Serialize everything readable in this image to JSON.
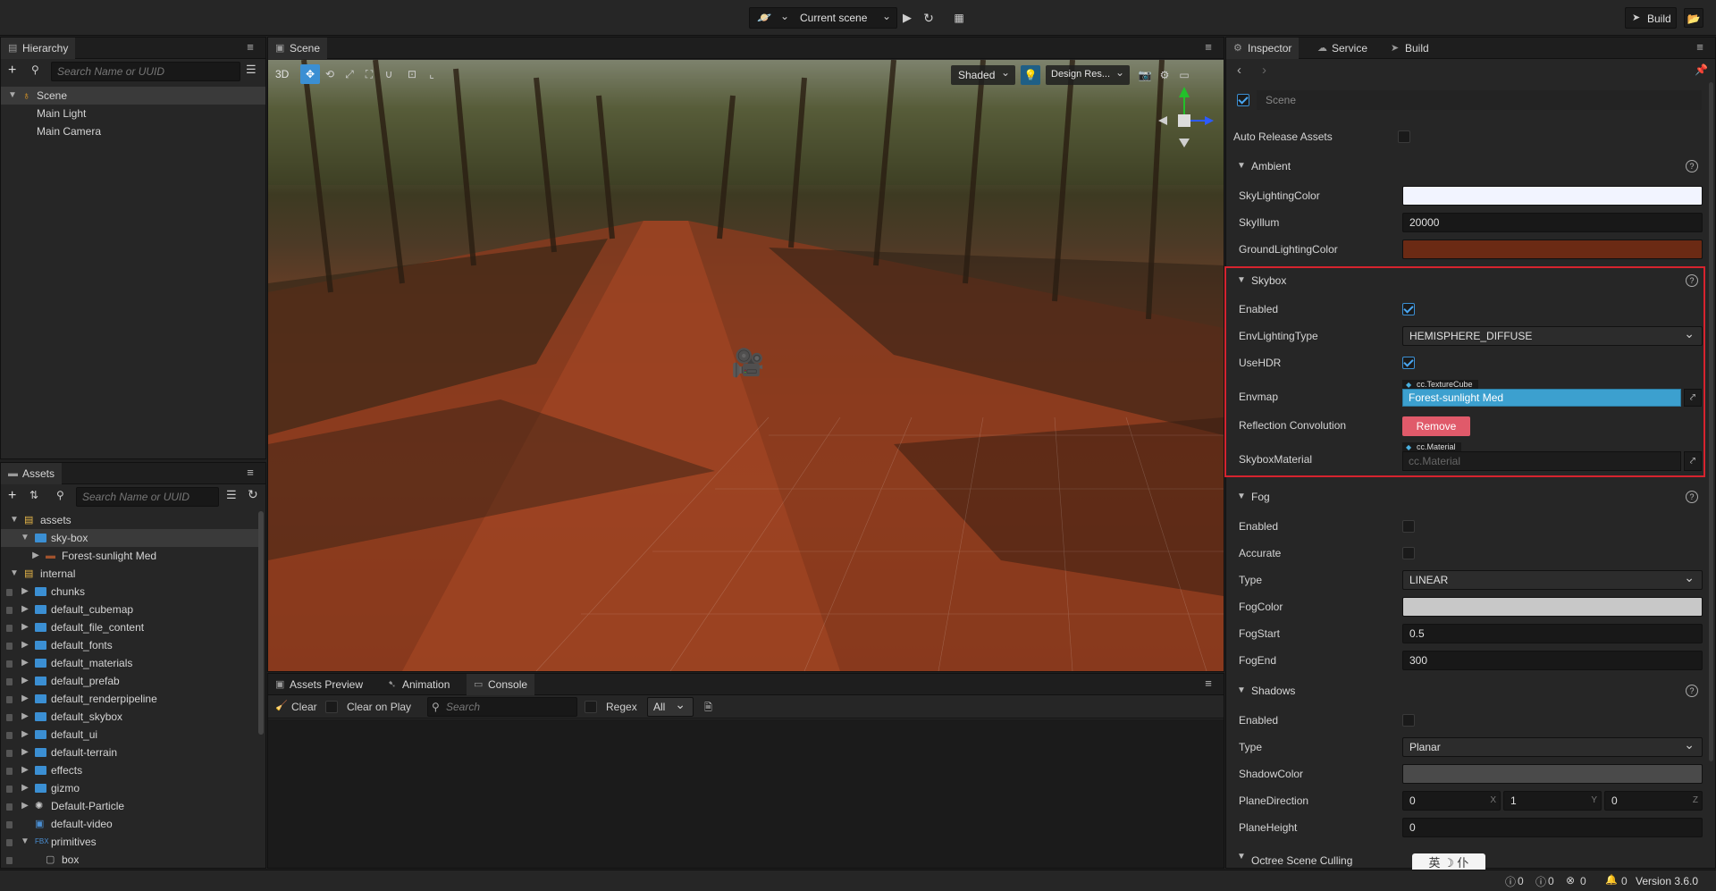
{
  "topbar": {
    "scene_select": "Current scene",
    "build_label": "Build"
  },
  "hierarchy": {
    "tab": "Hierarchy",
    "search_placeholder": "Search Name or UUID",
    "root": "Scene",
    "children": [
      "Main Light",
      "Main Camera"
    ]
  },
  "assets": {
    "tab": "Assets",
    "search_placeholder": "Search Name or UUID",
    "tree": [
      {
        "label": "assets",
        "indent": 0,
        "kind": "db",
        "arrow": "down"
      },
      {
        "label": "sky-box",
        "indent": 1,
        "kind": "folder",
        "arrow": "down",
        "selected": true
      },
      {
        "label": "Forest-sunlight Med",
        "indent": 2,
        "kind": "texture",
        "arrow": "right"
      },
      {
        "label": "internal",
        "indent": 0,
        "kind": "db",
        "arrow": "down"
      },
      {
        "label": "chunks",
        "indent": 1,
        "kind": "folder",
        "arrow": "right",
        "locked": true
      },
      {
        "label": "default_cubemap",
        "indent": 1,
        "kind": "folder",
        "arrow": "right",
        "locked": true
      },
      {
        "label": "default_file_content",
        "indent": 1,
        "kind": "folder",
        "arrow": "right",
        "locked": true
      },
      {
        "label": "default_fonts",
        "indent": 1,
        "kind": "folder",
        "arrow": "right",
        "locked": true
      },
      {
        "label": "default_materials",
        "indent": 1,
        "kind": "folder",
        "arrow": "right",
        "locked": true
      },
      {
        "label": "default_prefab",
        "indent": 1,
        "kind": "folder",
        "arrow": "right",
        "locked": true
      },
      {
        "label": "default_renderpipeline",
        "indent": 1,
        "kind": "folder",
        "arrow": "right",
        "locked": true
      },
      {
        "label": "default_skybox",
        "indent": 1,
        "kind": "folder",
        "arrow": "right",
        "locked": true
      },
      {
        "label": "default_ui",
        "indent": 1,
        "kind": "folder",
        "arrow": "right",
        "locked": true
      },
      {
        "label": "default-terrain",
        "indent": 1,
        "kind": "folder",
        "arrow": "right",
        "locked": true
      },
      {
        "label": "effects",
        "indent": 1,
        "kind": "folder",
        "arrow": "right",
        "locked": true
      },
      {
        "label": "gizmo",
        "indent": 1,
        "kind": "folder",
        "arrow": "right",
        "locked": true
      },
      {
        "label": "Default-Particle",
        "indent": 1,
        "kind": "particle",
        "arrow": "right",
        "locked": true
      },
      {
        "label": "default-video",
        "indent": 1,
        "kind": "video",
        "arrow": "none",
        "locked": true
      },
      {
        "label": "primitives",
        "indent": 1,
        "kind": "fbx",
        "arrow": "down",
        "locked": true
      },
      {
        "label": "box",
        "indent": 2,
        "kind": "mesh",
        "arrow": "none",
        "locked": true
      }
    ]
  },
  "scene": {
    "tab": "Scene",
    "mode_3d": "3D",
    "shading": "Shaded",
    "design_res": "Design Res..."
  },
  "bottom": {
    "tabs": [
      "Assets Preview",
      "Animation",
      "Console"
    ],
    "clear": "Clear",
    "clear_on_play": "Clear on Play",
    "search_placeholder": "Search",
    "regex": "Regex",
    "level": "All"
  },
  "inspector": {
    "tabs": [
      "Inspector",
      "Service",
      "Build"
    ],
    "node_name": "Scene",
    "auto_release": "Auto Release Assets",
    "ambient": {
      "title": "Ambient",
      "sky_color_label": "SkyLightingColor",
      "sky_color": "#f2f4ff",
      "sky_illum_label": "SkyIllum",
      "sky_illum": "20000",
      "ground_color_label": "GroundLightingColor",
      "ground_color": "#6b2a14"
    },
    "skybox": {
      "title": "Skybox",
      "enabled_label": "Enabled",
      "env_type_label": "EnvLightingType",
      "env_type": "HEMISPHERE_DIFFUSE",
      "hdr_label": "UseHDR",
      "envmap_label": "Envmap",
      "envmap_type": "cc.TextureCube",
      "envmap_value": "Forest-sunlight Med",
      "reflection_label": "Reflection Convolution",
      "remove_label": "Remove",
      "material_label": "SkyboxMaterial",
      "material_type": "cc.Material",
      "material_value": "cc.Material"
    },
    "fog": {
      "title": "Fog",
      "enabled_label": "Enabled",
      "accurate_label": "Accurate",
      "type_label": "Type",
      "type": "LINEAR",
      "color_label": "FogColor",
      "color": "#c8c8c8",
      "start_label": "FogStart",
      "start": "0.5",
      "end_label": "FogEnd",
      "end": "300"
    },
    "shadows": {
      "title": "Shadows",
      "enabled_label": "Enabled",
      "type_label": "Type",
      "type": "Planar",
      "color_label": "ShadowColor",
      "color": "#4a4a4a",
      "dir_label": "PlaneDirection",
      "dir_x": "0",
      "dir_y": "1",
      "dir_z": "0",
      "axis_x": "X",
      "axis_y": "Y",
      "axis_z": "Z",
      "height_label": "PlaneHeight",
      "height": "0"
    },
    "next_section": "Octree Scene Culling"
  },
  "statusbar": {
    "info": "0",
    "warn": "0",
    "err": "0",
    "notif": "0",
    "version": "Version 3.6.0",
    "ime": "英 ☽ 仆"
  },
  "colors": {
    "accent": "#3b8fd3",
    "highlight_border": "#d6232e",
    "remove_button": "#e05a6a",
    "envmap_field": "#3ca0cf"
  }
}
